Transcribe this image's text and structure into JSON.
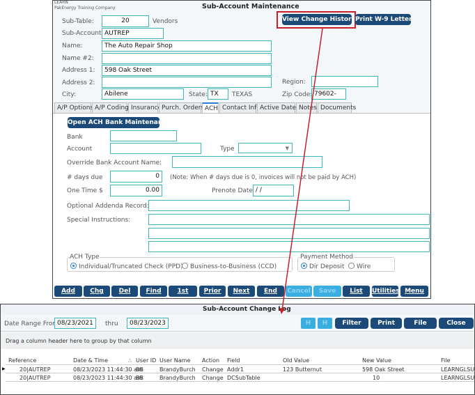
{
  "main": {
    "company_code": "LEARN",
    "company_name": "PakEnergy Training Company",
    "title": "Sub-Account Maintenance",
    "view_history_label": "View Change History",
    "print_w9_label": "Print W-9 Letter",
    "fields": {
      "sub_table_label": "Sub-Table:",
      "sub_table": "20",
      "sub_table_desc": "Vendors",
      "sub_account_label": "Sub-Account:",
      "sub_account": "AUTREP",
      "name_label": "Name:",
      "name": "The Auto Repair Shop",
      "name2_label": "Name #2:",
      "name2": "",
      "address1_label": "Address 1:",
      "address1": "598 Oak Street",
      "address2_label": "Address 2:",
      "address2": "",
      "region_label": "Region:",
      "region": "",
      "city_label": "City:",
      "city": "Abilene",
      "state_label": "State:",
      "state": "TX",
      "state_name": "TEXAS",
      "zip_label": "Zip Code:",
      "zip": "79602-"
    },
    "tabs": [
      "A/P Options",
      "A/P Coding",
      "Insurance",
      "Purch. Orders",
      "ACH",
      "Contact Info",
      "Active Dates",
      "Notes",
      "Documents"
    ],
    "active_tab": "ACH",
    "ach": {
      "open_bank_label": "Open ACH Bank Maintenance",
      "bank_label": "Bank",
      "bank": "",
      "account_label": "Account",
      "account": "",
      "type_label": "Type",
      "type": "",
      "override_label": "Override Bank Account Name:",
      "override": "",
      "days_due_label": "# days due",
      "days_due": "0",
      "note": "(Note:  When # days due is 0, invoices will not be paid by ACH)",
      "one_time_label": "One Time $",
      "one_time": "0.00",
      "prenote_label": "Prenote Date:",
      "prenote": " /  /",
      "addenda_label": "Optional Addenda Record:",
      "addenda": "",
      "special_label": "Special Instructions:",
      "ach_type_label": "ACH Type",
      "ach_type_options": [
        "Individual/Truncated Check (PPD)",
        "Business-to-Business (CCD)"
      ],
      "ach_type_selected": "Individual/Truncated Check (PPD)",
      "payment_label": "Payment Method",
      "payment_options": [
        "Dir Deposit",
        "Wire"
      ],
      "payment_selected": "Dir Deposit"
    },
    "toolbar": [
      "Add",
      "Chg",
      "Del",
      "Find",
      "1st",
      "Prior",
      "Next",
      "End",
      "Cancel",
      "Save",
      "List",
      "Utilities",
      "Menu"
    ],
    "toolbar_disabled": [
      "Cancel",
      "Save"
    ]
  },
  "log": {
    "title": "Sub-Account Change Log",
    "date_from_label": "Date Range From",
    "date_from": "08/23/2021",
    "thru_label": "thru",
    "date_thru": "08/23/2023",
    "buttons": [
      "Filter",
      "Print",
      "File",
      "Close"
    ],
    "nav_buttons": [
      "H",
      "H"
    ],
    "group_hint": "Drag a column header here to group by that column",
    "columns": [
      "Reference",
      "Date & Time",
      "User ID",
      "User Name",
      "Action",
      "Field",
      "Old Value",
      "New Value",
      "File"
    ],
    "rows": [
      [
        "20|AUTREP",
        "08/23/2023 11:44:30 am",
        "BB",
        "BrandyBurch",
        "Change",
        "Addr1",
        "123 Butternut",
        "598 Oak Street",
        "LEARNGLSUBA"
      ],
      [
        "20|AUTREP",
        "08/23/2023 11:44:30 am",
        "BB",
        "BrandyBurch",
        "Change",
        "DCSubTable",
        "",
        "10",
        "LEARNGLSUBA"
      ]
    ]
  },
  "colors": {
    "button": "#1c4a78",
    "field_border": "#3cb7b5",
    "highlight": "#c8202a",
    "disabled": "#3aaee0"
  }
}
